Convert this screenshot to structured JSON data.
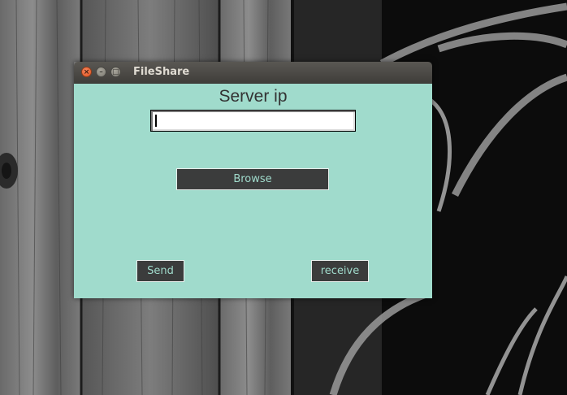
{
  "window": {
    "title": "FileShare",
    "controls": {
      "close": "×",
      "minimize": "–",
      "maximize": "□"
    }
  },
  "form": {
    "server_label": "Server ip",
    "server_ip_value": "",
    "browse_label": "Browse",
    "send_label": "Send",
    "receive_label": "receive"
  },
  "colors": {
    "background": "#a0dbcc",
    "button": "#3b3c3c",
    "titlebar": "#4a4944"
  }
}
